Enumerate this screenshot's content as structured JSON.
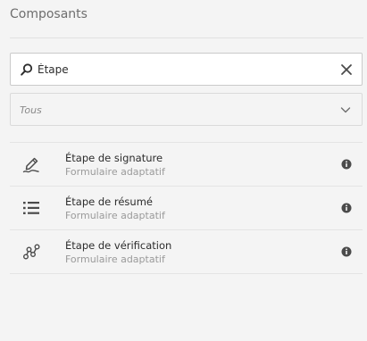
{
  "panel": {
    "title": "Composants"
  },
  "search": {
    "value": "Étape",
    "icon": "search-icon",
    "clear_icon": "close-icon"
  },
  "filter": {
    "selected": "Tous",
    "icon": "chevron-down-icon"
  },
  "components": [
    {
      "title": "Étape de signature",
      "subtitle": "Formulaire adaptatif",
      "icon": "signature-icon",
      "info_icon": "info-icon"
    },
    {
      "title": "Étape de résumé",
      "subtitle": "Formulaire adaptatif",
      "icon": "list-icon",
      "info_icon": "info-icon"
    },
    {
      "title": "Étape de vérification",
      "subtitle": "Formulaire adaptatif",
      "icon": "workflow-icon",
      "info_icon": "info-icon"
    }
  ],
  "colors": {
    "background": "#f4f4f4",
    "text": "#2c2c2c",
    "muted_text": "#9a9a9a",
    "icon": "#4b4b4b"
  }
}
